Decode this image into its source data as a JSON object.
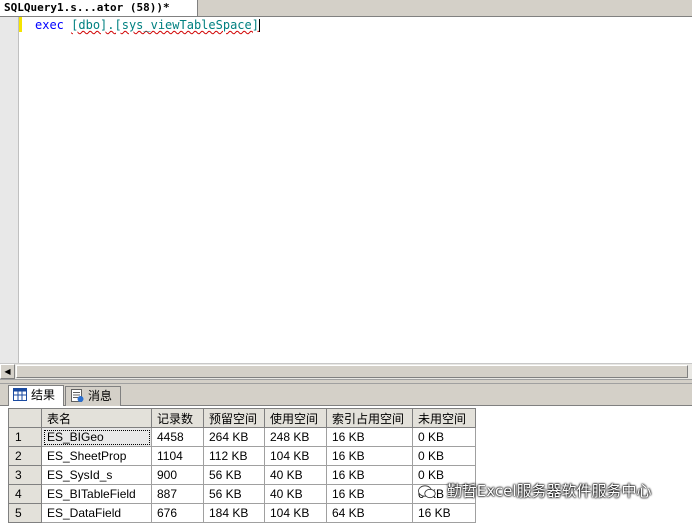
{
  "document_tab": {
    "title": "SQLQuery1.s...ator (58))*"
  },
  "editor": {
    "keyword": "exec",
    "object_name": "[dbo].[sys_viewTableSpace]"
  },
  "results": {
    "tabs": [
      {
        "label": "结果",
        "icon": "grid-icon"
      },
      {
        "label": "消息",
        "icon": "messages-icon"
      }
    ],
    "columns": [
      "表名",
      "记录数",
      "预留空间",
      "使用空间",
      "索引占用空间",
      "未用空间"
    ],
    "rows": [
      {
        "num": "1",
        "cells": [
          "ES_BIGeo",
          "4458",
          "264 KB",
          "248 KB",
          "16 KB",
          "0 KB"
        ]
      },
      {
        "num": "2",
        "cells": [
          "ES_SheetProp",
          "1104",
          "112 KB",
          "104 KB",
          "16 KB",
          "0 KB"
        ]
      },
      {
        "num": "3",
        "cells": [
          "ES_SysId_s",
          "900",
          "56 KB",
          "40 KB",
          "16 KB",
          "0 KB"
        ]
      },
      {
        "num": "4",
        "cells": [
          "ES_BITableField",
          "887",
          "56 KB",
          "40 KB",
          "16 KB",
          "0 KB"
        ]
      },
      {
        "num": "5",
        "cells": [
          "ES_DataField",
          "676",
          "184 KB",
          "104 KB",
          "64 KB",
          "16 KB"
        ]
      }
    ]
  },
  "watermark": {
    "text": "勤哲Excel服务器软件服务中心"
  }
}
